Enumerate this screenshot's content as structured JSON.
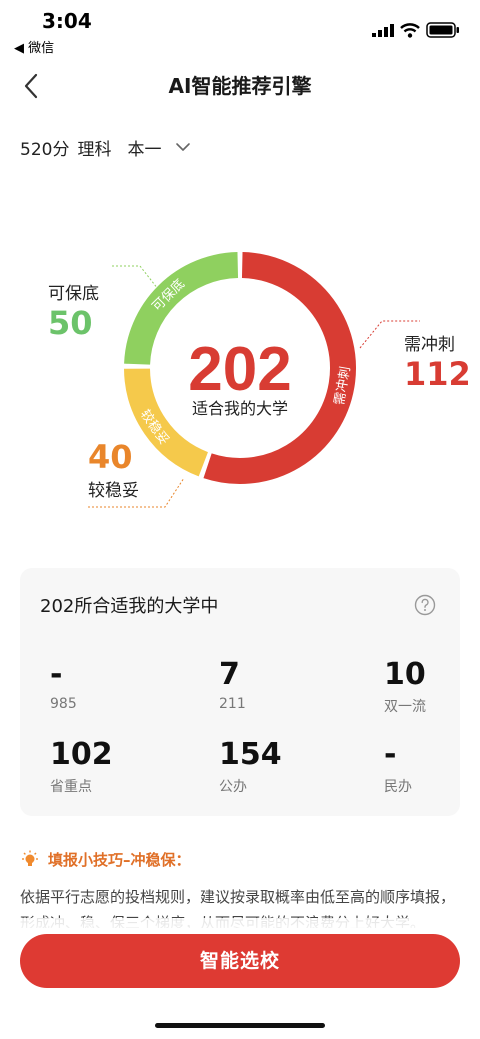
{
  "status": {
    "time": "3:04",
    "back_app": "◀ 微信"
  },
  "nav": {
    "title": "AI智能推荐引擎"
  },
  "filter": {
    "score": "520分",
    "subject": "理科",
    "batch": "本一"
  },
  "donut": {
    "total": "202",
    "caption": "适合我的大学",
    "segments": [
      {
        "name": "可保底",
        "ring_label": "可保底",
        "value": 50,
        "color": "#8fd05f"
      },
      {
        "name": "需冲刺",
        "ring_label": "需冲刺",
        "value": 112,
        "color": "#d83c33"
      },
      {
        "name": "较稳妥",
        "ring_label": "较稳妥",
        "value": 40,
        "color": "#f5c94b"
      }
    ],
    "labels": {
      "safe": {
        "text": "可保底",
        "num": "50",
        "color": "#6cc36a"
      },
      "reach": {
        "text": "需冲刺",
        "num": "112",
        "color": "#d83c33"
      },
      "stable": {
        "text": "较稳妥",
        "num": "40",
        "color": "#e9862b"
      }
    }
  },
  "card": {
    "title": "202所合适我的大学中",
    "stats": [
      {
        "value": "-",
        "label": "985"
      },
      {
        "value": "7",
        "label": "211"
      },
      {
        "value": "10",
        "label": "双一流"
      },
      {
        "value": "102",
        "label": "省重点"
      },
      {
        "value": "154",
        "label": "公办"
      },
      {
        "value": "-",
        "label": "民办"
      }
    ]
  },
  "tip": {
    "title": "填报小技巧–冲稳保：",
    "body": "依据平行志愿的投档规则，建议按录取概率由低至高的顺序填报，形成冲、稳、保三个梯度，从而尽可能的不浪费分上好大学。"
  },
  "cta": {
    "label": "智能选校"
  }
}
